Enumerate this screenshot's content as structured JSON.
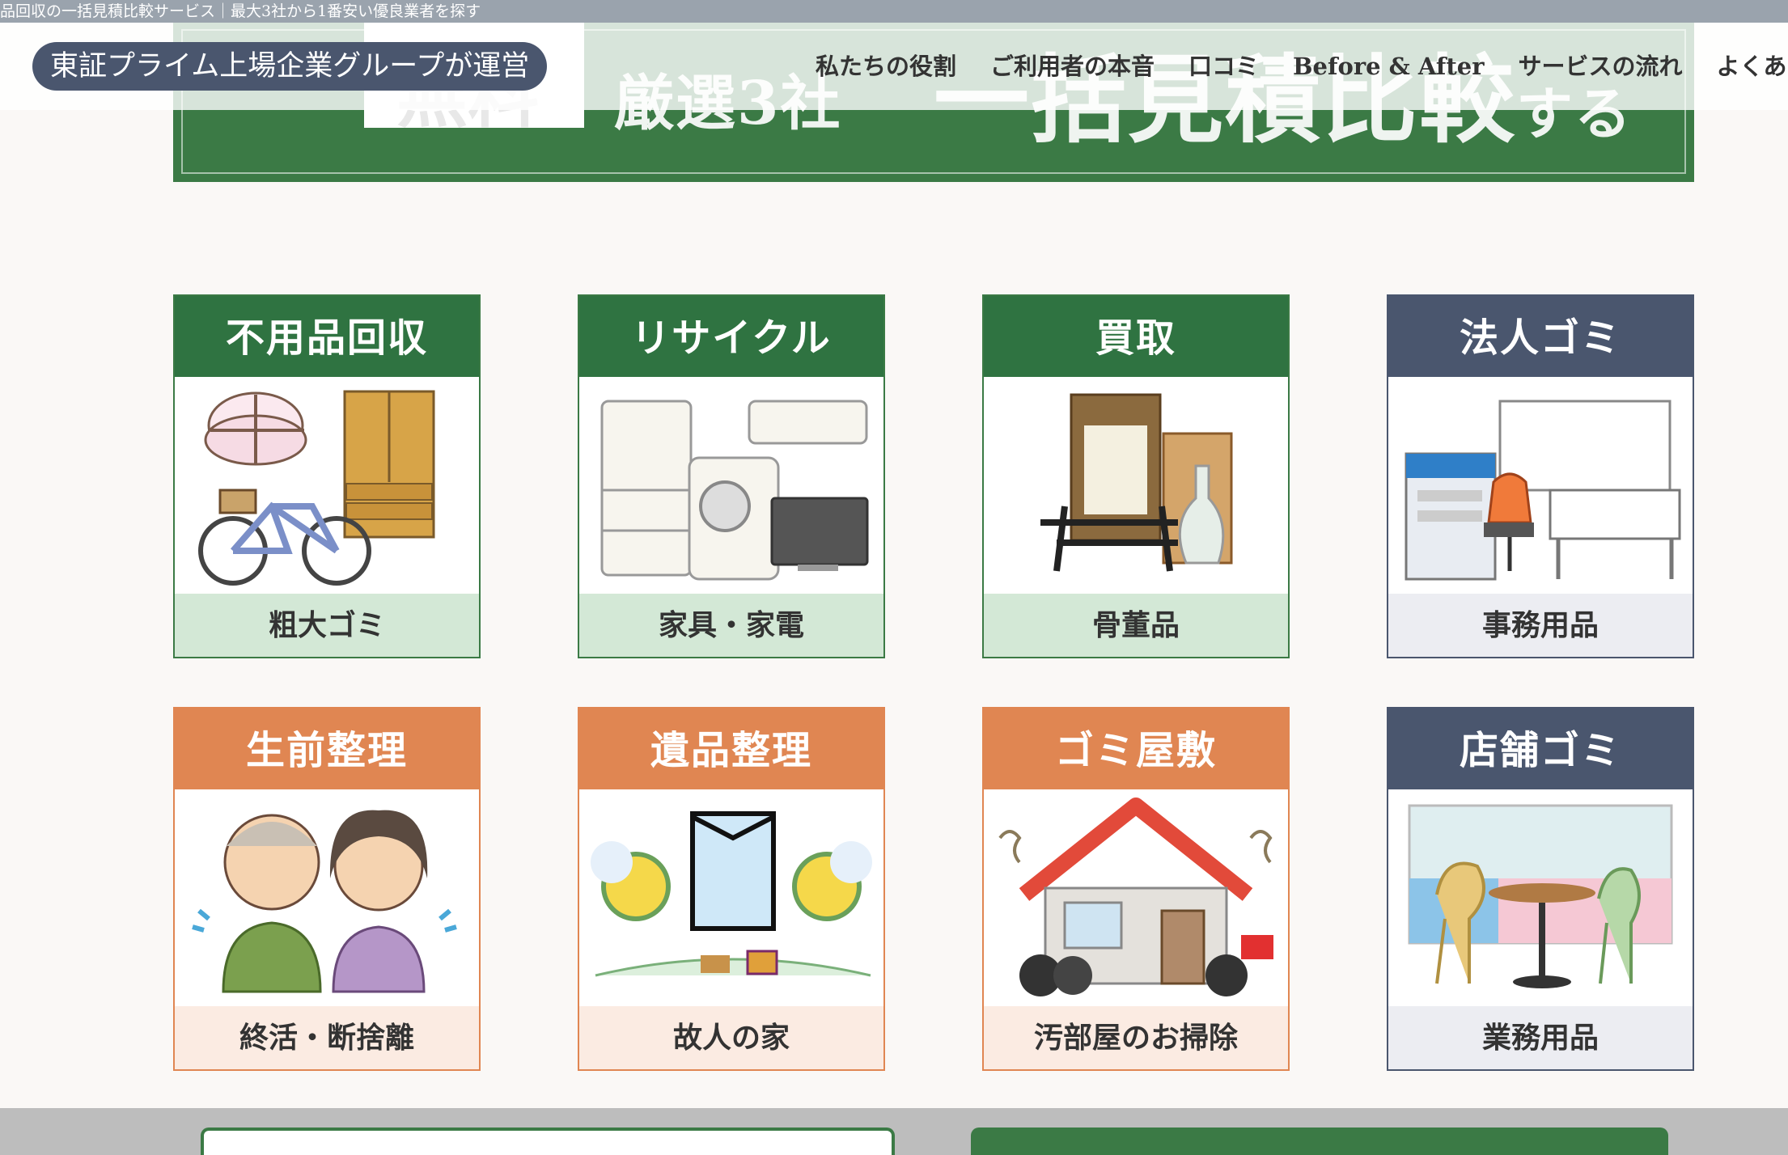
{
  "page_title": "品回収の一括見積比較サービス｜最大3社から1番安い優良業者を探す",
  "hero": {
    "box_text": "無料",
    "sub_text": "厳選3社",
    "main_text": "一括見積比較",
    "main_suffix": "する"
  },
  "header": {
    "badge": "東証プライム上場企業グループが運営",
    "nav": [
      "私たちの役割",
      "ご利用者の本音",
      "口コミ",
      "Before & After",
      "サービスの流れ",
      "よくある質問"
    ]
  },
  "cards": [
    {
      "title": "不用品回収",
      "caption": "粗大ゴミ",
      "theme": "green"
    },
    {
      "title": "リサイクル",
      "caption": "家具・家電",
      "theme": "green"
    },
    {
      "title": "買取",
      "caption": "骨董品",
      "theme": "green"
    },
    {
      "title": "法人ゴミ",
      "caption": "事務用品",
      "theme": "navy"
    },
    {
      "title": "生前整理",
      "caption": "終活・断捨離",
      "theme": "orange"
    },
    {
      "title": "遺品整理",
      "caption": "故人の家",
      "theme": "orange"
    },
    {
      "title": "ゴミ屋敷",
      "caption": "汚部屋のお掃除",
      "theme": "orange"
    },
    {
      "title": "店舗ゴミ",
      "caption": "業務用品",
      "theme": "navy"
    }
  ],
  "colors": {
    "green": "#2f7341",
    "navy": "#4a566e",
    "orange": "#e08652"
  }
}
